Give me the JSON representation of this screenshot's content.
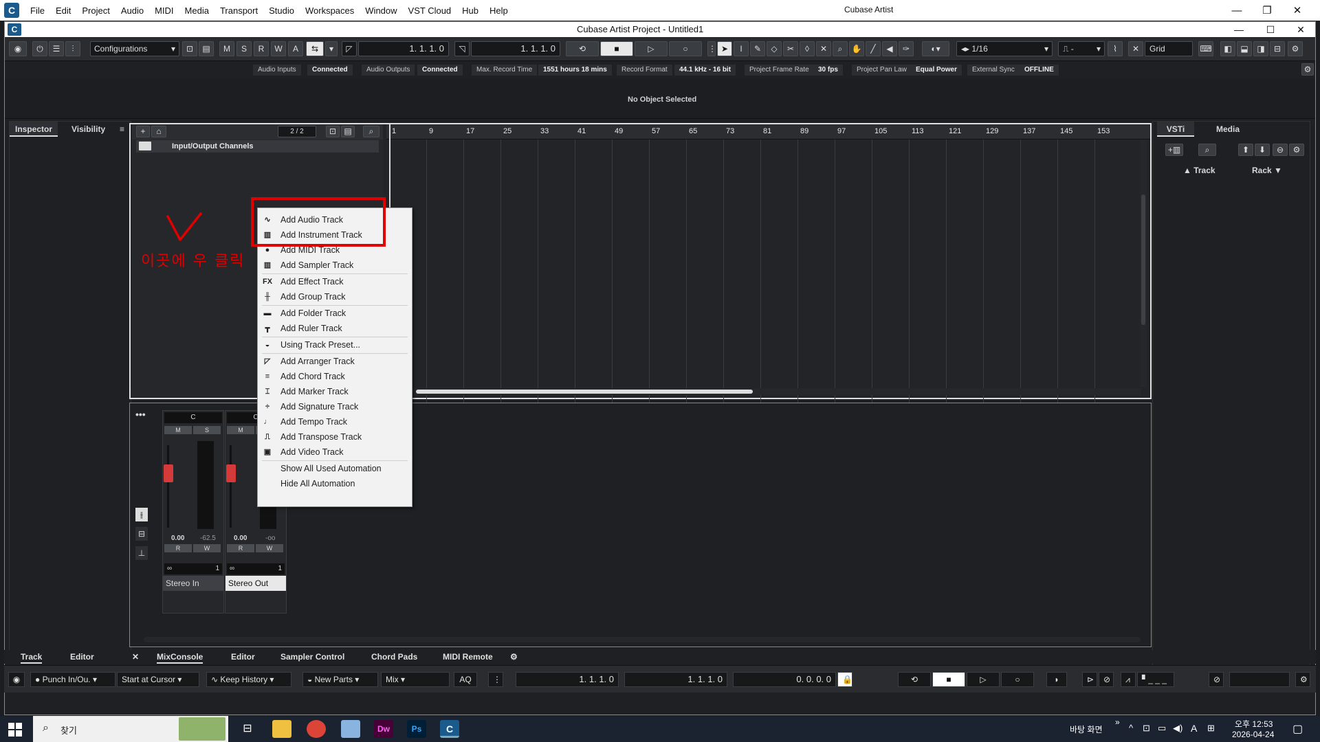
{
  "os_title": {
    "app_title": "Cubase Artist",
    "menu": [
      "File",
      "Edit",
      "Project",
      "Audio",
      "MIDI",
      "Media",
      "Transport",
      "Studio",
      "Workspaces",
      "Window",
      "VST Cloud",
      "Hub",
      "Help"
    ]
  },
  "project": {
    "title": "Cubase Artist Project - Untitled1"
  },
  "toolbar": {
    "configurations": "Configurations",
    "m": "M",
    "s": "S",
    "r": "R",
    "w": "W",
    "a": "A",
    "pos_left": "1. 1. 1.  0",
    "pos_right": "1. 1. 1.  0",
    "quantize": "1/16",
    "grid": "Grid",
    "snap_dash": "-"
  },
  "status": {
    "audio_inputs_label": "Audio Inputs",
    "audio_inputs": "Connected",
    "audio_outputs_label": "Audio Outputs",
    "audio_outputs": "Connected",
    "max_rec_label": "Max. Record Time",
    "max_rec": "1551 hours 18 mins",
    "rec_format_label": "Record Format",
    "rec_format": "44.1 kHz - 16 bit",
    "frame_rate_label": "Project Frame Rate",
    "frame_rate": "30 fps",
    "pan_law_label": "Project Pan Law",
    "pan_law": "Equal Power",
    "ext_sync_label": "External Sync",
    "ext_sync": "OFFLINE"
  },
  "info": {
    "text": "No Object Selected"
  },
  "inspector": {
    "tab_inspector": "Inspector",
    "tab_visibility": "Visibility"
  },
  "tracklist": {
    "count": "2 / 2",
    "io_channels": "Input/Output Channels"
  },
  "ruler": [
    "1",
    "9",
    "17",
    "25",
    "33",
    "41",
    "49",
    "57",
    "65",
    "73",
    "81",
    "89",
    "97",
    "105",
    "113",
    "121",
    "129",
    "137",
    "145",
    "153"
  ],
  "context_menu": [
    {
      "icon": "audio-waveform-icon",
      "glyph": "∿",
      "label": "Add Audio Track"
    },
    {
      "icon": "instrument-keys-icon",
      "glyph": "▥",
      "label": "Add Instrument Track"
    },
    {
      "icon": "midi-port-icon",
      "glyph": "●",
      "label": "Add MIDI Track"
    },
    {
      "icon": "sampler-icon",
      "glyph": "▥",
      "label": "Add Sampler Track"
    },
    {
      "icon": "fx-icon",
      "glyph": "FX",
      "label": "Add Effect Track"
    },
    {
      "icon": "group-icon",
      "glyph": "╫",
      "label": "Add Group Track"
    },
    {
      "icon": "folder-icon",
      "glyph": "▬",
      "label": "Add Folder Track"
    },
    {
      "icon": "ruler-icon",
      "glyph": "┳",
      "label": "Add Ruler Track"
    },
    {
      "icon": "preset-icon",
      "glyph": "◒",
      "label": "Using Track Preset..."
    },
    {
      "icon": "arranger-icon",
      "glyph": "◸",
      "label": "Add Arranger Track"
    },
    {
      "icon": "chord-icon",
      "glyph": "≡",
      "label": "Add Chord Track"
    },
    {
      "icon": "marker-icon",
      "glyph": "⌶",
      "label": "Add Marker Track"
    },
    {
      "icon": "signature-icon",
      "glyph": "÷",
      "label": "Add Signature Track"
    },
    {
      "icon": "tempo-icon",
      "glyph": "♩",
      "label": "Add Tempo Track"
    },
    {
      "icon": "transpose-icon",
      "glyph": "⎍",
      "label": "Add Transpose Track"
    },
    {
      "icon": "video-icon",
      "glyph": "▣",
      "label": "Add Video Track"
    },
    {
      "icon": "",
      "glyph": "",
      "label": "Show All Used Automation"
    },
    {
      "icon": "",
      "glyph": "",
      "label": "Hide All Automation"
    }
  ],
  "annotation": {
    "text": "이곳에 우 클릭",
    "color": "#e00000"
  },
  "mixer": {
    "ch1_name": "Stereo In",
    "ch2_name": "Stereo Out",
    "ch1_vol": "0.00",
    "ch1_peak": "-62.5",
    "ch2_vol": "0.00",
    "ch2_peak": "-oo",
    "ch_c": "C",
    "r": "R",
    "w": "W",
    "m": "M",
    "s": "S",
    "ch_num": "1"
  },
  "right_zone": {
    "tab_vsti": "VSTi",
    "tab_media": "Media",
    "col_track": "Track",
    "col_rack": "Rack"
  },
  "bottom_tabs": {
    "track": "Track",
    "editor": "Editor",
    "mixconsole": "MixConsole",
    "editor2": "Editor",
    "sampler": "Sampler Control",
    "chord": "Chord Pads",
    "midi": "MIDI Remote"
  },
  "transport": {
    "punch": "Punch In/Ou.",
    "start": "Start at Cursor",
    "history": "Keep History",
    "newparts": "New Parts",
    "mix": "Mix",
    "aq": "AQ",
    "pos1": "1. 1. 1.  0",
    "pos2": "1. 1. 1.  0",
    "pos3": "0. 0. 0.  0"
  },
  "taskbar": {
    "search": "찾기",
    "desktop": "바탕 화면",
    "time": "오후 12:53",
    "date": "2026-04-24",
    "ime": "A"
  }
}
